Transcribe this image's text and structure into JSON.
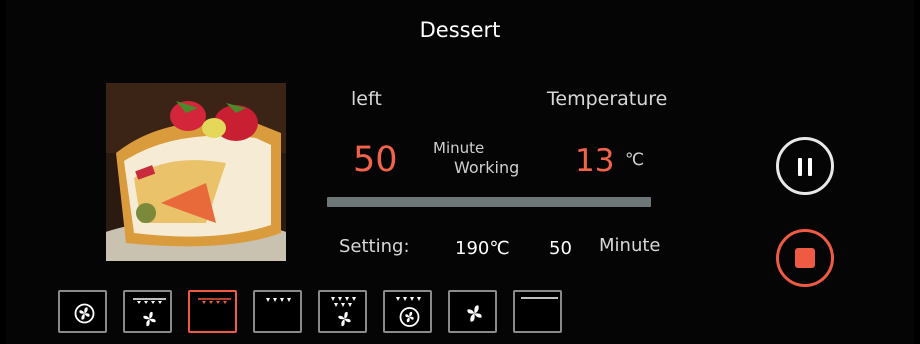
{
  "header": {
    "title": "Dessert"
  },
  "photo": {
    "subject": "strawberry cream roll cake"
  },
  "status": {
    "left_label": "left",
    "temperature_label": "Temperature",
    "remaining_value": "50",
    "remaining_unit": "Minute",
    "state_text": "Working",
    "current_temp_value": "13",
    "temp_unit": "℃",
    "progress_fraction": 0.0
  },
  "settings": {
    "label": "Setting:",
    "temp_value": "190℃",
    "time_value": "50",
    "time_unit": "Minute"
  },
  "controls": {
    "pause_icon": "pause-icon",
    "stop_icon": "stop-icon",
    "pause_color": "#e8e8e8",
    "stop_color": "#ee5b42"
  },
  "modes": [
    {
      "icon": "fan-icon",
      "active": false
    },
    {
      "icon": "top-heat-fan-icon",
      "active": false
    },
    {
      "icon": "top-heat-icon",
      "active": true
    },
    {
      "icon": "top-heat-small-icon",
      "active": false
    },
    {
      "icon": "top-heat-fan-icon",
      "active": false
    },
    {
      "icon": "top-heat-circle-fan-icon",
      "active": false
    },
    {
      "icon": "fan-only-icon",
      "active": false
    },
    {
      "icon": "bottom-heat-icon",
      "active": false
    }
  ],
  "accent_color": "#f2634a"
}
